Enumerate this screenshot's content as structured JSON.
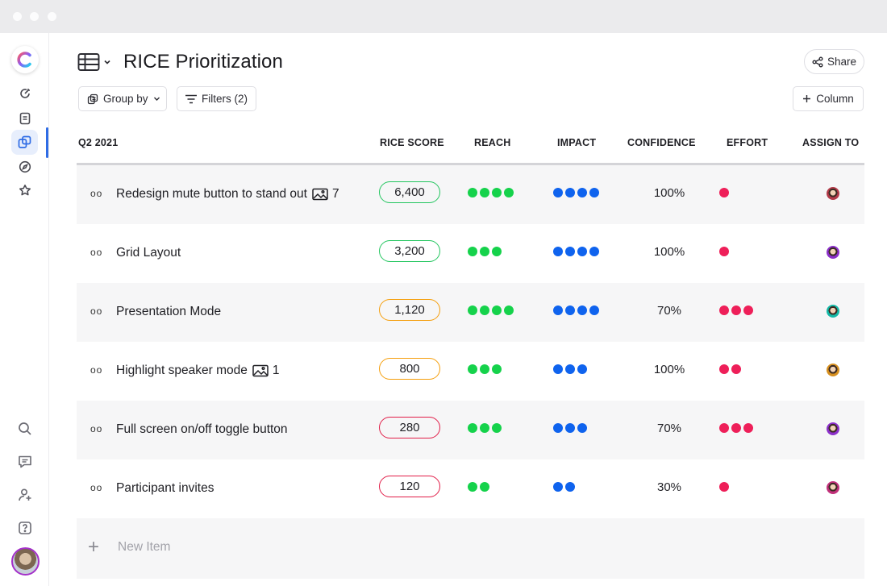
{
  "window": {
    "controls": [
      "close",
      "minimize",
      "maximize"
    ]
  },
  "sidebar": {
    "logo": "clickup-logo",
    "items": [
      {
        "icon": "activity-icon"
      },
      {
        "icon": "document-icon"
      },
      {
        "icon": "boards-icon",
        "active": true
      },
      {
        "icon": "compass-icon"
      },
      {
        "icon": "star-icon"
      }
    ],
    "bottom": [
      {
        "icon": "search-icon"
      },
      {
        "icon": "chat-icon"
      },
      {
        "icon": "add-user-icon"
      },
      {
        "icon": "help-icon"
      }
    ]
  },
  "header": {
    "title": "RICE Prioritization",
    "share_label": "Share",
    "group_by_label": "Group by",
    "filters_label": "Filters (2)",
    "column_label": "Column"
  },
  "table": {
    "group_name": "Q2 2021",
    "columns": {
      "rice": "RICE SCORE",
      "reach": "REACH",
      "impact": "IMPACT",
      "confidence": "CONFIDENCE",
      "effort": "EFFORT",
      "assign": "ASSIGN TO"
    },
    "rows": [
      {
        "name": "Redesign mute button to stand out",
        "attachments": "7",
        "rice": "6,400",
        "rice_color": "#22c55e",
        "reach": 4,
        "impact": 4,
        "confidence": "100%",
        "effort": 1,
        "avatar_color": "#b23a48"
      },
      {
        "name": "Grid Layout",
        "attachments": "",
        "rice": "3,200",
        "rice_color": "#22c55e",
        "reach": 3,
        "impact": 4,
        "confidence": "100%",
        "effort": 1,
        "avatar_color": "#8b2fc9"
      },
      {
        "name": "Presentation Mode",
        "attachments": "",
        "rice": "1,120",
        "rice_color": "#f59e0b",
        "reach": 4,
        "impact": 4,
        "confidence": "70%",
        "effort": 3,
        "avatar_color": "#14b8a6"
      },
      {
        "name": "Highlight speaker mode",
        "attachments": "1",
        "rice": "800",
        "rice_color": "#f59e0b",
        "reach": 3,
        "impact": 3,
        "confidence": "100%",
        "effort": 2,
        "avatar_color": "#d68f1f"
      },
      {
        "name": "Full screen on/off toggle button",
        "attachments": "",
        "rice": "280",
        "rice_color": "#e11d48",
        "reach": 3,
        "impact": 3,
        "confidence": "70%",
        "effort": 3,
        "avatar_color": "#8b2fc9"
      },
      {
        "name": "Participant invites",
        "attachments": "",
        "rice": "120",
        "rice_color": "#e11d48",
        "reach": 2,
        "impact": 2,
        "confidence": "30%",
        "effort": 1,
        "avatar_color": "#c1307a"
      }
    ],
    "new_item_label": "New Item"
  },
  "colors": {
    "reach": "#15d24b",
    "impact": "#0f63ee",
    "effort": "#ee1f59",
    "accent": "#2f6ce5"
  }
}
